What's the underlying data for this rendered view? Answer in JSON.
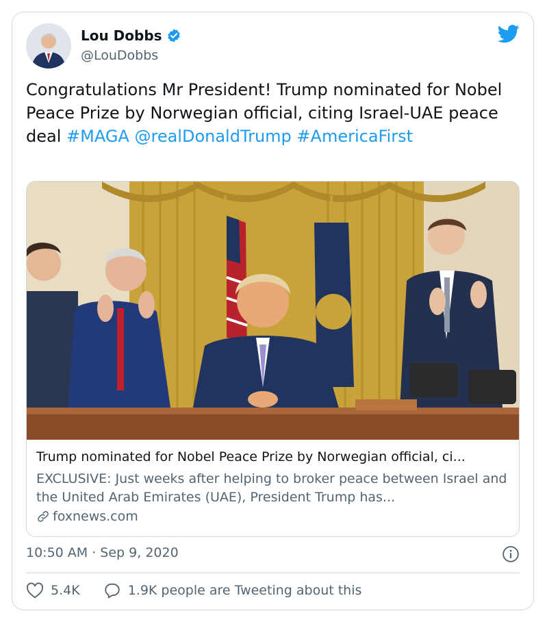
{
  "author": {
    "name": "Lou Dobbs",
    "handle": "@LouDobbs",
    "verified_icon": "verified-badge-icon",
    "brand_icon": "twitter-bird-icon"
  },
  "tweet": {
    "text_plain": "Congratulations Mr President!  Trump nominated for Nobel Peace Prize by Norwegian official, citing Israel-UAE peace deal ",
    "hashtag_maga": "#MAGA",
    "mention": "@realDonaldTrump",
    "hashtag_america_first": "#AmericaFirst"
  },
  "link_card": {
    "title": "Trump nominated for Nobel Peace Prize by Norwegian official, ci...",
    "description": "EXCLUSIVE: Just weeks after helping to broker peace between Israel and the United Arab Emirates (UAE), President Trump has...",
    "domain": "foxnews.com",
    "link_icon": "link-icon"
  },
  "meta": {
    "timestamp": "10:50 AM · Sep 9, 2020",
    "info_icon": "info-icon"
  },
  "actions": {
    "likes": "5.4K",
    "replies_text": "1.9K people are Tweeting about this"
  },
  "colors": {
    "link": "#1d9bf0",
    "secondary_text": "#536471",
    "border": "#cfd9de"
  }
}
